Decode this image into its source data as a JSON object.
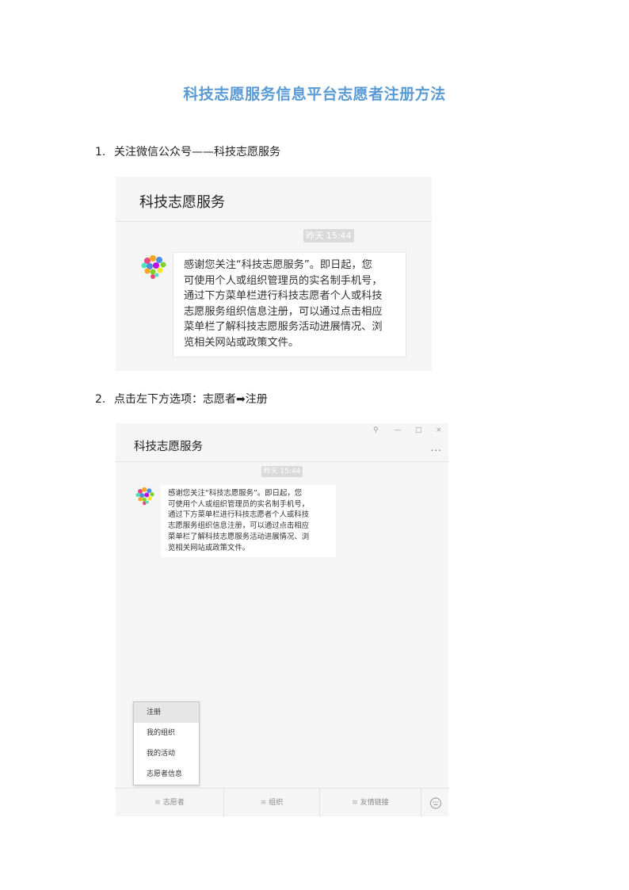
{
  "document": {
    "title": "科技志愿服务信息平台志愿者注册方法",
    "steps": [
      {
        "num": "1.",
        "text": "关注微信公众号——科技志愿服务"
      },
      {
        "num": "2.",
        "text": "点击左下方选项：志愿者➡注册"
      }
    ]
  },
  "screenshot1": {
    "header_title": "科技志愿服务",
    "timestamp": "昨天 15:44",
    "message_lines": [
      "感谢您关注“科技志愿服务”。即日起，您",
      "可使用个人或组织管理员的实名制手机号，",
      "通过下方菜单栏进行科技志愿者个人或科技",
      "志愿服务组织信息注册，可以通过点击相应",
      "菜单栏了解科技志愿服务活动进展情况、浏",
      "览相关网站或政策文件。"
    ]
  },
  "screenshot2": {
    "header_title": "科技志愿服务",
    "window_controls": [
      "pin-icon",
      "minimize-icon",
      "maximize-icon",
      "close-icon"
    ],
    "more_label": "...",
    "timestamp": "昨天 15:44",
    "message_lines": [
      "感谢您关注“科技志愿服务”。即日起，您",
      "可使用个人或组织管理员的实名制手机号，",
      "通过下方菜单栏进行科技志愿者个人或科技",
      "志愿服务组织信息注册，可以通过点击相应",
      "菜单栏了解科技志愿服务活动进展情况、浏",
      "览相关网站或政策文件。"
    ],
    "popup_menu": [
      "注册",
      "我的组织",
      "我的活动",
      "志愿者信息"
    ],
    "bottom_menu": [
      "志愿者",
      "组织",
      "友情链接"
    ],
    "keyboard_icon": "keyboard-icon"
  }
}
